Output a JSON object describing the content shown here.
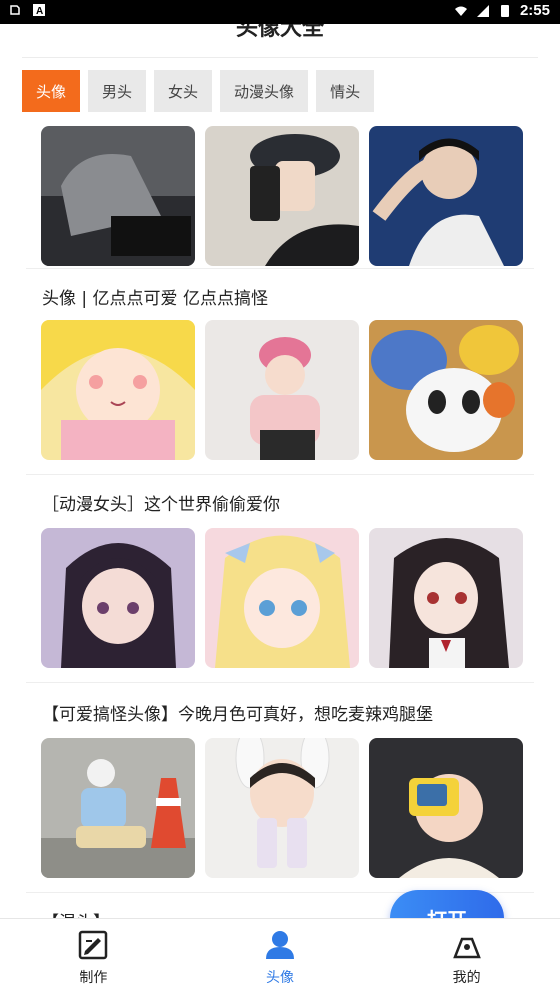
{
  "status_bar": {
    "time": "2:55"
  },
  "header": {
    "title": "头像大全"
  },
  "tabs": [
    {
      "label": "头像",
      "active": true
    },
    {
      "label": "男头",
      "active": false
    },
    {
      "label": "女头",
      "active": false
    },
    {
      "label": "动漫头像",
      "active": false
    },
    {
      "label": "情头",
      "active": false
    }
  ],
  "sections": [
    {
      "title": "头像 | 亿点点可爱 亿点点搞怪"
    },
    {
      "title": "［动漫女头］这个世界偷偷爱你"
    },
    {
      "title": "【可爱搞怪头像】今晚月色可真好，想吃麦辣鸡腿堡"
    },
    {
      "title": "【混头】"
    }
  ],
  "fab": {
    "label": "打开"
  },
  "bottom_nav": [
    {
      "label": "制作",
      "icon": "edit-icon"
    },
    {
      "label": "头像",
      "icon": "user-icon",
      "active": true
    },
    {
      "label": "我的",
      "icon": "profile-icon"
    }
  ],
  "colors": {
    "accent": "#f36b1c",
    "nav_active": "#2f7ae5",
    "fab": "#3b8df5"
  }
}
